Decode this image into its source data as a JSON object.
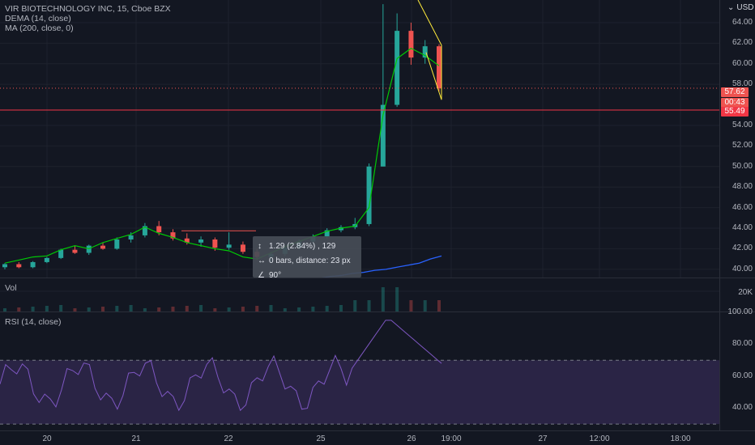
{
  "legend": {
    "title": "VIR BIOTECHNOLOGY INC, 15, Cboe BZX",
    "dema": "DEMA (14, close)",
    "ma": "MA (200, close, 0)"
  },
  "currency": "USD",
  "price_ticks": [
    "64.00",
    "62.00",
    "60.00",
    "58.00",
    "54.00",
    "52.00",
    "50.00",
    "48.00",
    "46.00",
    "44.00",
    "42.00",
    "40.00"
  ],
  "price_tags": {
    "last": "57.62",
    "countdown": "00:43",
    "line": "55.49"
  },
  "vol_label": "Vol",
  "vol_tick": "20K",
  "rsi_label": "RSI (14, close)",
  "rsi_ticks": [
    "100.00",
    "80.00",
    "60.00",
    "40.00"
  ],
  "x_ticks": [
    "20",
    "21",
    "22",
    "25",
    "26",
    "19:00",
    "27",
    "12:00",
    "18:00"
  ],
  "tooltip": {
    "change": "1.29 (2.84%) , 129",
    "bars": "0 bars, distance: 23 px",
    "angle": "90°"
  },
  "colors": {
    "background": "#131722",
    "up": "#26a69a",
    "down": "#ef5350",
    "dema": "#00c805",
    "ma": "#2962ff",
    "rsi_band": "#7e57c2",
    "drawing": "#ffeb3b",
    "hline": "#f23645"
  },
  "chart_data": {
    "type": "line",
    "series": [
      {
        "name": "DEMA (14, close)",
        "values": [
          40.6,
          40.9,
          41.2,
          41.3,
          41.9,
          42.3,
          42.0,
          42.6,
          43.0,
          43.4,
          44.1,
          43.5,
          43.1,
          42.6,
          42.3,
          42.0,
          41.8,
          41.2,
          41.0,
          41.6,
          42.2,
          42.7,
          43.2,
          43.7,
          44.0,
          44.2,
          46.0,
          55.0,
          60.5,
          61.5,
          60.8,
          59.8
        ]
      },
      {
        "name": "MA (200, close, 0)",
        "values": [
          39.0,
          39.1,
          39.3,
          39.4,
          39.6,
          39.7,
          39.9,
          40.0,
          40.2,
          40.4,
          40.6,
          41.0,
          41.3
        ]
      }
    ],
    "candles": [
      [
        40.2,
        40.6,
        40.0,
        40.5
      ],
      [
        40.5,
        40.7,
        40.1,
        40.2
      ],
      [
        40.2,
        40.8,
        40.1,
        40.7
      ],
      [
        40.7,
        41.2,
        40.6,
        41.1
      ],
      [
        41.1,
        42.0,
        41.0,
        41.9
      ],
      [
        41.9,
        42.3,
        41.5,
        41.6
      ],
      [
        41.6,
        42.4,
        41.4,
        42.3
      ],
      [
        42.3,
        42.6,
        41.9,
        42.0
      ],
      [
        42.0,
        43.1,
        41.9,
        42.9
      ],
      [
        42.9,
        43.6,
        42.6,
        43.3
      ],
      [
        43.3,
        44.5,
        43.1,
        44.2
      ],
      [
        44.2,
        44.7,
        43.3,
        43.6
      ],
      [
        43.6,
        43.9,
        42.8,
        43.0
      ],
      [
        43.0,
        43.5,
        42.4,
        42.6
      ],
      [
        42.6,
        43.2,
        42.2,
        42.9
      ],
      [
        42.9,
        43.1,
        41.8,
        42.1
      ],
      [
        42.1,
        43.6,
        41.9,
        42.4
      ],
      [
        42.4,
        42.7,
        41.5,
        41.7
      ],
      [
        41.7,
        42.0,
        40.9,
        41.2
      ],
      [
        41.2,
        41.7,
        40.7,
        41.5
      ],
      [
        41.5,
        42.3,
        41.3,
        42.1
      ],
      [
        42.1,
        42.9,
        41.9,
        42.7
      ],
      [
        42.7,
        43.4,
        42.5,
        43.2
      ],
      [
        43.2,
        44.0,
        43.0,
        43.8
      ],
      [
        43.8,
        44.3,
        43.6,
        44.1
      ],
      [
        44.1,
        45.0,
        43.9,
        44.4
      ],
      [
        44.4,
        50.3,
        44.2,
        50.0
      ],
      [
        50.0,
        65.8,
        50.0,
        56.0
      ],
      [
        56.0,
        64.9,
        55.8,
        63.2
      ],
      [
        63.2,
        64.0,
        59.9,
        60.6
      ],
      [
        60.6,
        62.3,
        60.0,
        61.7
      ],
      [
        61.7,
        61.9,
        57.3,
        57.6
      ]
    ],
    "ylim": [
      39.2,
      66.2
    ],
    "rsi": {
      "ylim": [
        26,
        100
      ],
      "upper": 70,
      "lower": 30
    }
  }
}
